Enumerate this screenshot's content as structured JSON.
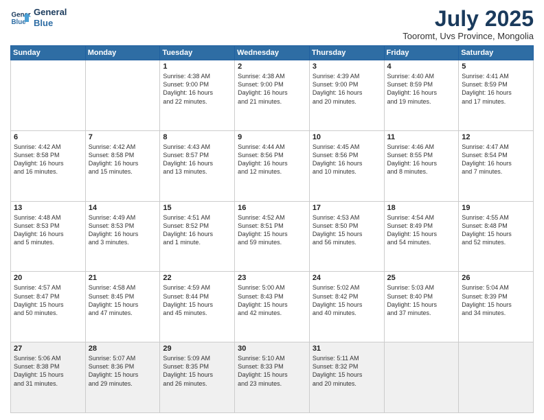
{
  "header": {
    "logo_line1": "General",
    "logo_line2": "Blue",
    "month": "July 2025",
    "location": "Tooromt, Uvs Province, Mongolia"
  },
  "days_of_week": [
    "Sunday",
    "Monday",
    "Tuesday",
    "Wednesday",
    "Thursday",
    "Friday",
    "Saturday"
  ],
  "weeks": [
    [
      {
        "day": "",
        "text": ""
      },
      {
        "day": "",
        "text": ""
      },
      {
        "day": "1",
        "text": "Sunrise: 4:38 AM\nSunset: 9:00 PM\nDaylight: 16 hours\nand 22 minutes."
      },
      {
        "day": "2",
        "text": "Sunrise: 4:38 AM\nSunset: 9:00 PM\nDaylight: 16 hours\nand 21 minutes."
      },
      {
        "day": "3",
        "text": "Sunrise: 4:39 AM\nSunset: 9:00 PM\nDaylight: 16 hours\nand 20 minutes."
      },
      {
        "day": "4",
        "text": "Sunrise: 4:40 AM\nSunset: 8:59 PM\nDaylight: 16 hours\nand 19 minutes."
      },
      {
        "day": "5",
        "text": "Sunrise: 4:41 AM\nSunset: 8:59 PM\nDaylight: 16 hours\nand 17 minutes."
      }
    ],
    [
      {
        "day": "6",
        "text": "Sunrise: 4:42 AM\nSunset: 8:58 PM\nDaylight: 16 hours\nand 16 minutes."
      },
      {
        "day": "7",
        "text": "Sunrise: 4:42 AM\nSunset: 8:58 PM\nDaylight: 16 hours\nand 15 minutes."
      },
      {
        "day": "8",
        "text": "Sunrise: 4:43 AM\nSunset: 8:57 PM\nDaylight: 16 hours\nand 13 minutes."
      },
      {
        "day": "9",
        "text": "Sunrise: 4:44 AM\nSunset: 8:56 PM\nDaylight: 16 hours\nand 12 minutes."
      },
      {
        "day": "10",
        "text": "Sunrise: 4:45 AM\nSunset: 8:56 PM\nDaylight: 16 hours\nand 10 minutes."
      },
      {
        "day": "11",
        "text": "Sunrise: 4:46 AM\nSunset: 8:55 PM\nDaylight: 16 hours\nand 8 minutes."
      },
      {
        "day": "12",
        "text": "Sunrise: 4:47 AM\nSunset: 8:54 PM\nDaylight: 16 hours\nand 7 minutes."
      }
    ],
    [
      {
        "day": "13",
        "text": "Sunrise: 4:48 AM\nSunset: 8:53 PM\nDaylight: 16 hours\nand 5 minutes."
      },
      {
        "day": "14",
        "text": "Sunrise: 4:49 AM\nSunset: 8:53 PM\nDaylight: 16 hours\nand 3 minutes."
      },
      {
        "day": "15",
        "text": "Sunrise: 4:51 AM\nSunset: 8:52 PM\nDaylight: 16 hours\nand 1 minute."
      },
      {
        "day": "16",
        "text": "Sunrise: 4:52 AM\nSunset: 8:51 PM\nDaylight: 15 hours\nand 59 minutes."
      },
      {
        "day": "17",
        "text": "Sunrise: 4:53 AM\nSunset: 8:50 PM\nDaylight: 15 hours\nand 56 minutes."
      },
      {
        "day": "18",
        "text": "Sunrise: 4:54 AM\nSunset: 8:49 PM\nDaylight: 15 hours\nand 54 minutes."
      },
      {
        "day": "19",
        "text": "Sunrise: 4:55 AM\nSunset: 8:48 PM\nDaylight: 15 hours\nand 52 minutes."
      }
    ],
    [
      {
        "day": "20",
        "text": "Sunrise: 4:57 AM\nSunset: 8:47 PM\nDaylight: 15 hours\nand 50 minutes."
      },
      {
        "day": "21",
        "text": "Sunrise: 4:58 AM\nSunset: 8:45 PM\nDaylight: 15 hours\nand 47 minutes."
      },
      {
        "day": "22",
        "text": "Sunrise: 4:59 AM\nSunset: 8:44 PM\nDaylight: 15 hours\nand 45 minutes."
      },
      {
        "day": "23",
        "text": "Sunrise: 5:00 AM\nSunset: 8:43 PM\nDaylight: 15 hours\nand 42 minutes."
      },
      {
        "day": "24",
        "text": "Sunrise: 5:02 AM\nSunset: 8:42 PM\nDaylight: 15 hours\nand 40 minutes."
      },
      {
        "day": "25",
        "text": "Sunrise: 5:03 AM\nSunset: 8:40 PM\nDaylight: 15 hours\nand 37 minutes."
      },
      {
        "day": "26",
        "text": "Sunrise: 5:04 AM\nSunset: 8:39 PM\nDaylight: 15 hours\nand 34 minutes."
      }
    ],
    [
      {
        "day": "27",
        "text": "Sunrise: 5:06 AM\nSunset: 8:38 PM\nDaylight: 15 hours\nand 31 minutes."
      },
      {
        "day": "28",
        "text": "Sunrise: 5:07 AM\nSunset: 8:36 PM\nDaylight: 15 hours\nand 29 minutes."
      },
      {
        "day": "29",
        "text": "Sunrise: 5:09 AM\nSunset: 8:35 PM\nDaylight: 15 hours\nand 26 minutes."
      },
      {
        "day": "30",
        "text": "Sunrise: 5:10 AM\nSunset: 8:33 PM\nDaylight: 15 hours\nand 23 minutes."
      },
      {
        "day": "31",
        "text": "Sunrise: 5:11 AM\nSunset: 8:32 PM\nDaylight: 15 hours\nand 20 minutes."
      },
      {
        "day": "",
        "text": ""
      },
      {
        "day": "",
        "text": ""
      }
    ]
  ]
}
